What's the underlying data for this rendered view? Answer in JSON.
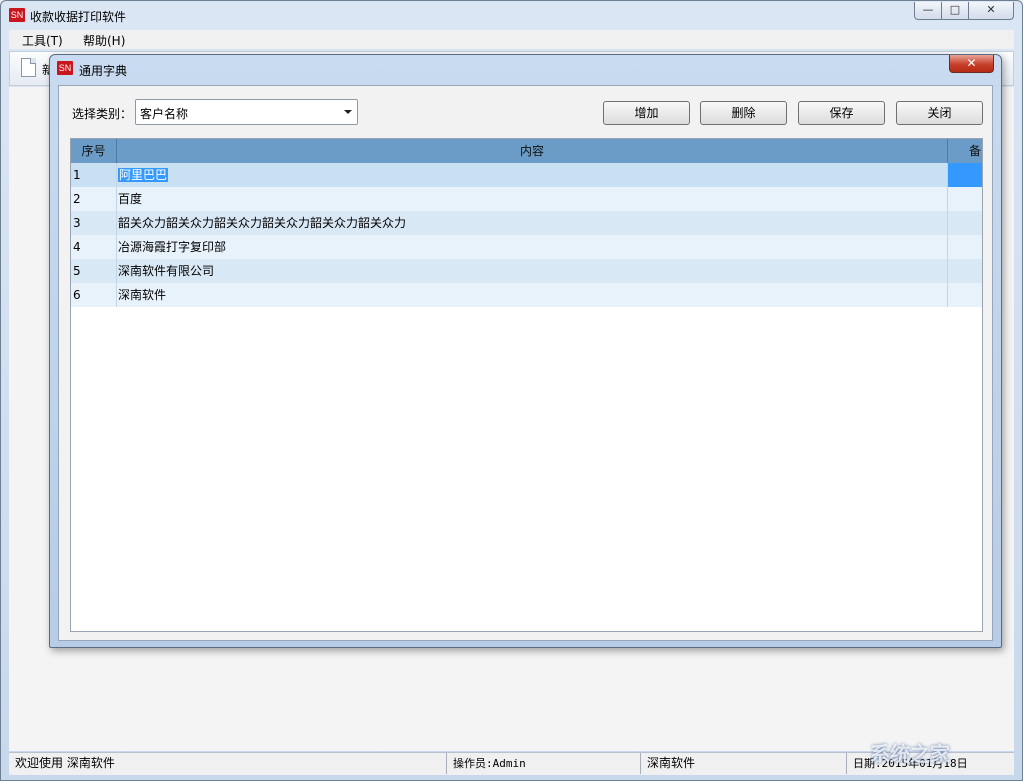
{
  "app": {
    "icon_text": "SN",
    "title": "收款收据打印软件"
  },
  "window_controls": {
    "minimize": "—",
    "maximize": "□",
    "close": "✕"
  },
  "menu": {
    "items": [
      {
        "label": "工具(T)"
      },
      {
        "label": "帮助(H)"
      }
    ]
  },
  "toolbar": {
    "partial_label": "新"
  },
  "dialog": {
    "icon_text": "SN",
    "title": "通用字典",
    "close": "✕",
    "category_label": "选择类别：",
    "category_value": "客户名称",
    "buttons": {
      "add": "增加",
      "delete": "删除",
      "save": "保存",
      "close": "关闭"
    },
    "grid": {
      "headers": {
        "index": "序号",
        "content": "内容",
        "note": "备"
      },
      "rows": [
        {
          "index": "1",
          "content": "阿里巴巴"
        },
        {
          "index": "2",
          "content": "百度"
        },
        {
          "index": "3",
          "content": "韶关众力韶关众力韶关众力韶关众力韶关众力韶关众力"
        },
        {
          "index": "4",
          "content": "冶源海霞打字复印部"
        },
        {
          "index": "5",
          "content": "深南软件有限公司"
        },
        {
          "index": "6",
          "content": "深南软件"
        }
      ]
    }
  },
  "status_bar": {
    "welcome": "欢迎使用 深南软件",
    "operator": "操作员:Admin",
    "company": "深南软件",
    "date": "日期:2015年01月18日"
  },
  "watermark": "系统之家",
  "colors": {
    "header_bg": "#6b9cc8",
    "selection": "#3399ff",
    "row_odd": "#d9e8f5",
    "row_even": "#e8f2fb",
    "close_red": "#c7402a",
    "brand_red": "#c9151e"
  }
}
